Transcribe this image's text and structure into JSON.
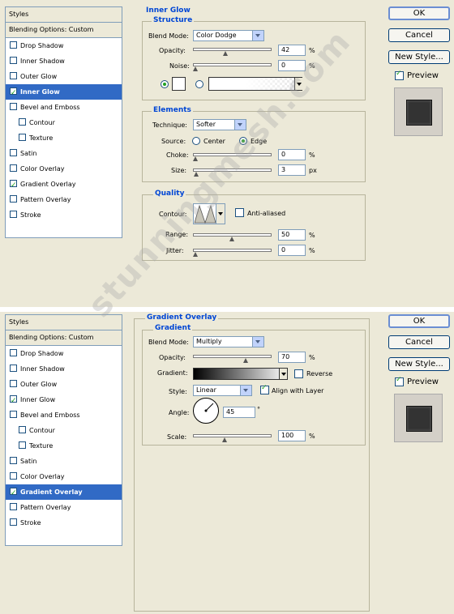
{
  "top": {
    "styles_header": "Styles",
    "blending_options": "Blending Options: Custom",
    "items": [
      {
        "label": "Drop Shadow",
        "checked": false,
        "selected": false,
        "indent": false
      },
      {
        "label": "Inner Shadow",
        "checked": false,
        "selected": false,
        "indent": false
      },
      {
        "label": "Outer Glow",
        "checked": false,
        "selected": false,
        "indent": false
      },
      {
        "label": "Inner Glow",
        "checked": true,
        "selected": true,
        "indent": false
      },
      {
        "label": "Bevel and Emboss",
        "checked": false,
        "selected": false,
        "indent": false
      },
      {
        "label": "Contour",
        "checked": false,
        "selected": false,
        "indent": true
      },
      {
        "label": "Texture",
        "checked": false,
        "selected": false,
        "indent": true
      },
      {
        "label": "Satin",
        "checked": false,
        "selected": false,
        "indent": false
      },
      {
        "label": "Color Overlay",
        "checked": false,
        "selected": false,
        "indent": false
      },
      {
        "label": "Gradient Overlay",
        "checked": true,
        "selected": false,
        "indent": false
      },
      {
        "label": "Pattern Overlay",
        "checked": false,
        "selected": false,
        "indent": false
      },
      {
        "label": "Stroke",
        "checked": false,
        "selected": false,
        "indent": false
      }
    ],
    "panel_title": "Inner Glow",
    "structure_title": "Structure",
    "blend_mode_label": "Blend Mode:",
    "blend_mode_value": "Color Dodge",
    "opacity_label": "Opacity:",
    "opacity_value": "42",
    "opacity_fraction": 0.42,
    "noise_label": "Noise:",
    "noise_value": "0",
    "noise_fraction": 0,
    "percent": "%",
    "elements_title": "Elements",
    "technique_label": "Technique:",
    "technique_value": "Softer",
    "source_label": "Source:",
    "center_label": "Center",
    "edge_label": "Edge",
    "choke_label": "Choke:",
    "choke_value": "0",
    "choke_fraction": 0,
    "size_label": "Size:",
    "size_value": "3",
    "size_fraction": 0.01,
    "px": "px",
    "quality_title": "Quality",
    "contour_label": "Contour:",
    "anti_aliased_label": "Anti-aliased",
    "range_label": "Range:",
    "range_value": "50",
    "range_fraction": 0.5,
    "jitter_label": "Jitter:",
    "jitter_value": "0",
    "jitter_fraction": 0,
    "ok_label": "OK",
    "cancel_label": "Cancel",
    "new_style_label": "New Style...",
    "preview_label": "Preview"
  },
  "bottom": {
    "styles_header": "Styles",
    "blending_options": "Blending Options: Custom",
    "items": [
      {
        "label": "Drop Shadow",
        "checked": false,
        "selected": false,
        "indent": false
      },
      {
        "label": "Inner Shadow",
        "checked": false,
        "selected": false,
        "indent": false
      },
      {
        "label": "Outer Glow",
        "checked": false,
        "selected": false,
        "indent": false
      },
      {
        "label": "Inner Glow",
        "checked": true,
        "selected": false,
        "indent": false
      },
      {
        "label": "Bevel and Emboss",
        "checked": false,
        "selected": false,
        "indent": false
      },
      {
        "label": "Contour",
        "checked": false,
        "selected": false,
        "indent": true
      },
      {
        "label": "Texture",
        "checked": false,
        "selected": false,
        "indent": true
      },
      {
        "label": "Satin",
        "checked": false,
        "selected": false,
        "indent": false
      },
      {
        "label": "Color Overlay",
        "checked": false,
        "selected": false,
        "indent": false
      },
      {
        "label": "Gradient Overlay",
        "checked": true,
        "selected": true,
        "indent": false
      },
      {
        "label": "Pattern Overlay",
        "checked": false,
        "selected": false,
        "indent": false
      },
      {
        "label": "Stroke",
        "checked": false,
        "selected": false,
        "indent": false
      }
    ],
    "panel_title": "Gradient Overlay",
    "gradient_title": "Gradient",
    "blend_mode_label": "Blend Mode:",
    "blend_mode_value": "Multiply",
    "opacity_label": "Opacity:",
    "opacity_value": "70",
    "opacity_fraction": 0.7,
    "gradient_label": "Gradient:",
    "reverse_label": "Reverse",
    "style_label": "Style:",
    "style_value": "Linear",
    "align_label": "Align with Layer",
    "angle_label": "Angle:",
    "angle_value": "45",
    "degree": "°",
    "scale_label": "Scale:",
    "scale_value": "100",
    "scale_fraction": 0.4,
    "percent": "%",
    "ok_label": "OK",
    "cancel_label": "Cancel",
    "new_style_label": "New Style...",
    "preview_label": "Preview"
  },
  "watermark": "stunningmesh.com",
  "colors": {
    "dialog_bg": "#ECE9D8",
    "selection": "#316AC5",
    "group_title": "#0046D5",
    "check_green": "#21A121"
  }
}
